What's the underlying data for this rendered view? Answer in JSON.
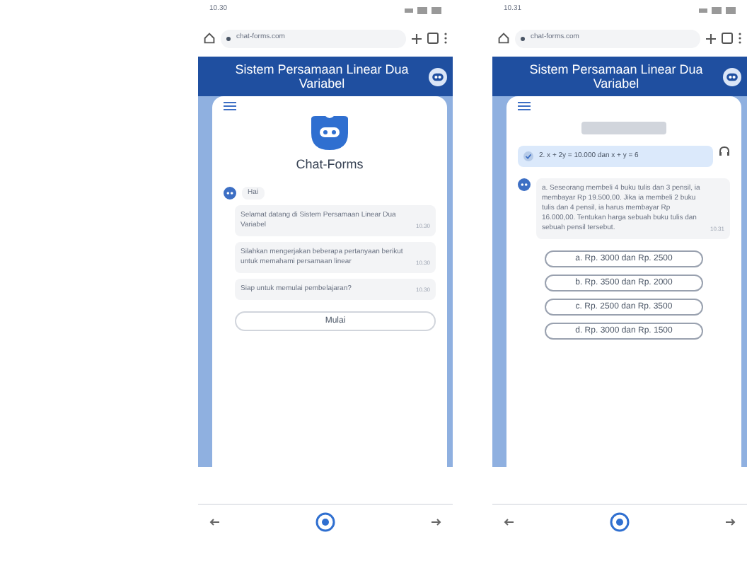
{
  "phones": [
    {
      "status_time": "10.30",
      "url": "chat-forms.com",
      "header_title": "Sistem Persamaan Linear Dua Variabel",
      "screen": {
        "kind": "intro",
        "app_name": "Chat-Forms",
        "greeting": "Hai",
        "messages": [
          {
            "text": "Selamat datang di Sistem Persamaan Linear Dua Variabel",
            "time": "10.30"
          },
          {
            "text": "Silahkan mengerjakan beberapa pertanyaan berikut untuk memahami persamaan linear",
            "time": "10.30"
          },
          {
            "text": "Siap untuk memulai pembelajaran?",
            "time": "10.30"
          }
        ],
        "start_button": "Mulai"
      }
    },
    {
      "status_time": "10.31",
      "url": "chat-forms.com",
      "header_title": "Sistem Persamaan Linear Dua Variabel",
      "screen": {
        "kind": "quiz",
        "user_message": "2. x + 2y = 10.000 dan x + y = 6",
        "bot_message": {
          "text": "a. Seseorang membeli 4 buku tulis dan 3 pensil, ia membayar Rp 19.500,00. Jika ia membeli 2 buku tulis dan 4 pensil, ia harus membayar Rp 16.000,00. Tentukan harga sebuah buku tulis dan sebuah pensil tersebut.",
          "time": "10.31"
        },
        "options": [
          {
            "label": "a. Rp. 3000 dan Rp. 2500"
          },
          {
            "label": "b. Rp. 3500 dan Rp. 2000"
          },
          {
            "label": "c. Rp. 2500 dan Rp. 3500"
          },
          {
            "label": "d. Rp. 3000 dan Rp. 1500"
          }
        ]
      }
    }
  ]
}
